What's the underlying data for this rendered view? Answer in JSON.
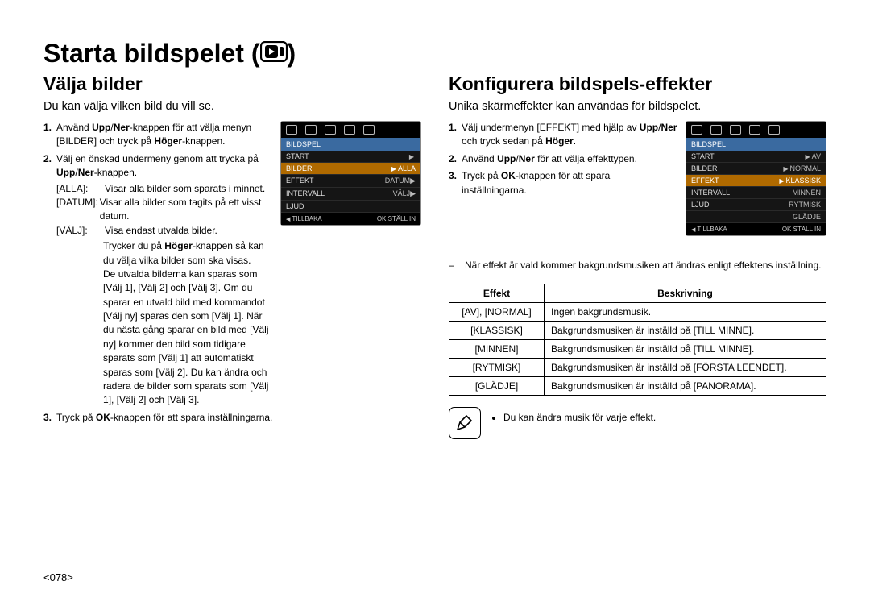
{
  "title": "Starta bildspelet (",
  "title_close": ")",
  "left": {
    "heading": "Välja bilder",
    "intro": "Du kan välja vilken bild du vill se.",
    "step1_pre": "Använd ",
    "step1_b1": "Upp",
    "step1_slash": "/",
    "step1_b2": "Ner",
    "step1_mid": "-knappen för att välja menyn [BILDER] och tryck på ",
    "step1_b3": "Höger",
    "step1_end": "-knappen.",
    "step2_pre": "Välj en önskad undermeny genom att trycka på ",
    "step2_b1": "Upp",
    "step2_b2": "Ner",
    "step2_end": "-knappen.",
    "def_alla_t": "[ALLA]:",
    "def_alla_d": "Visar alla bilder som sparats i minnet.",
    "def_datum_t": "[DATUM]:",
    "def_datum_d": "Visar alla bilder som tagits på ett visst datum.",
    "def_valj_t": "[VÄLJ]:",
    "def_valj_d": "Visa endast utvalda bilder.",
    "after_pre": "Trycker du på ",
    "after_b": "Höger",
    "after_mid": "-knappen så kan du välja vilka bilder som ska visas.",
    "after2": "De utvalda bilderna kan sparas som [Välj 1], [Välj 2] och [Välj 3]. Om du sparar en utvald bild med kommandot [Välj ny] sparas den som [Välj 1]. När du nästa gång sparar en bild med [Välj ny] kommer den bild som tidigare sparats som [Välj 1] att automatiskt sparas som [Välj 2]. Du kan ändra och radera de bilder som sparats som [Välj 1], [Välj 2] och [Välj 3].",
    "step3_pre": "Tryck på ",
    "step3_b": "OK",
    "step3_end": "-knappen för att spara inställningarna.",
    "lcd": {
      "title": "BILDSPEL",
      "rows": [
        {
          "l": "START",
          "r": ""
        },
        {
          "l": "BILDER",
          "r": "ALLA",
          "sel": true
        },
        {
          "l": "EFFEKT",
          "r": "DATUM▶"
        },
        {
          "l": "INTERVALL",
          "r": "VÄLJ▶"
        },
        {
          "l": "LJUD",
          "r": ""
        }
      ],
      "foot_l": "TILLBAKA",
      "foot_r": "STÄLL IN",
      "foot_ok": "OK"
    }
  },
  "right": {
    "heading": "Konfigurera bildspels-effekter",
    "intro": "Unika skärmeffekter kan användas för bildspelet.",
    "step1_pre": "Välj undermenyn [EFFEKT] med hjälp av ",
    "step1_b1": "Upp",
    "step1_b2": "Ner",
    "step1_mid": " och tryck sedan på ",
    "step1_b3": "Höger",
    "step1_end": ".",
    "step2_pre": "Använd ",
    "step2_b1": "Upp",
    "step2_b2": "Ner",
    "step2_end": " för att välja effekttypen.",
    "step3_pre": "Tryck på ",
    "step3_b": "OK",
    "step3_end": "-knappen för att spara inställningarna.",
    "lcd": {
      "title": "BILDSPEL",
      "rows": [
        {
          "l": "START",
          "r": "AV"
        },
        {
          "l": "BILDER",
          "r": "NORMAL"
        },
        {
          "l": "EFFEKT",
          "r": "KLASSISK",
          "sel": true
        },
        {
          "l": "INTERVALL",
          "r": "MINNEN"
        },
        {
          "l": "LJUD",
          "r": "RYTMISK"
        },
        {
          "l": "",
          "r": "GLÄDJE"
        }
      ],
      "foot_l": "TILLBAKA",
      "foot_r": "STÄLL IN",
      "foot_ok": "OK"
    },
    "note_dash": "–",
    "note": "När effekt är vald kommer bakgrundsmusiken att ändras enligt effektens inställning.",
    "th1": "Effekt",
    "th2": "Beskrivning",
    "rows": [
      {
        "e": "[AV], [NORMAL]",
        "d": "Ingen bakgrundsmusik."
      },
      {
        "e": "[KLASSISK]",
        "d": "Bakgrundsmusiken är inställd på [TILL MINNE]."
      },
      {
        "e": "[MINNEN]",
        "d": "Bakgrundsmusiken är inställd på [TILL MINNE]."
      },
      {
        "e": "[RYTMISK]",
        "d": "Bakgrundsmusiken är inställd på [FÖRSTA LEENDET]."
      },
      {
        "e": "[GLÄDJE]",
        "d": "Bakgrundsmusiken är inställd på [PANORAMA]."
      }
    ],
    "pnote": "Du kan ändra musik för varje effekt."
  },
  "pagenum": "<078>"
}
